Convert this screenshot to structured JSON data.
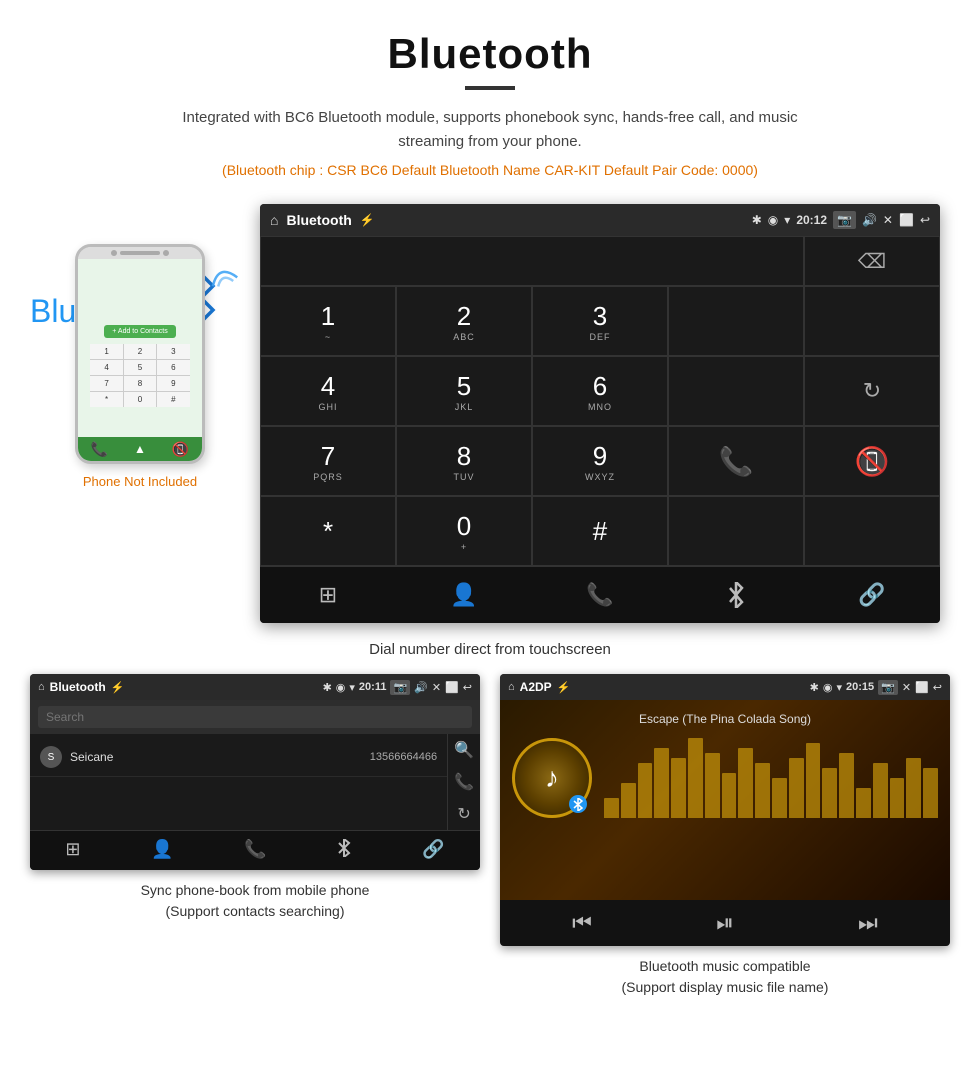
{
  "header": {
    "title": "Bluetooth",
    "subtitle": "Integrated with BC6 Bluetooth module, supports phonebook sync, hands-free call, and music streaming from your phone.",
    "specs": "(Bluetooth chip : CSR BC6    Default Bluetooth Name CAR-KIT    Default Pair Code: 0000)"
  },
  "phone": {
    "label": "Phone Not Included",
    "add_contacts": "+ Add to Contacts",
    "keys": [
      "1",
      "2",
      "3",
      "4",
      "5",
      "6",
      "7",
      "8",
      "9",
      "*",
      "0",
      "#"
    ]
  },
  "dial_screen": {
    "title": "Bluetooth",
    "time": "20:12",
    "keys": [
      {
        "num": "1",
        "sub": ""
      },
      {
        "num": "2",
        "sub": "ABC"
      },
      {
        "num": "3",
        "sub": "DEF"
      },
      {
        "num": "4",
        "sub": "GHI"
      },
      {
        "num": "5",
        "sub": "JKL"
      },
      {
        "num": "6",
        "sub": "MNO"
      },
      {
        "num": "7",
        "sub": "PQRS"
      },
      {
        "num": "8",
        "sub": "TUV"
      },
      {
        "num": "9",
        "sub": "WXYZ"
      },
      {
        "num": "*",
        "sub": ""
      },
      {
        "num": "0",
        "sub": "+"
      },
      {
        "num": "#",
        "sub": ""
      }
    ],
    "nav_icons": [
      "⊞",
      "👤",
      "📞",
      "✱",
      "⛓"
    ]
  },
  "main_caption": "Dial number direct from touchscreen",
  "phonebook_screen": {
    "title": "Bluetooth",
    "time": "20:11",
    "search_placeholder": "Search",
    "contact": {
      "initial": "S",
      "name": "Seicane",
      "number": "13566664466"
    }
  },
  "music_screen": {
    "title": "A2DP",
    "time": "20:15",
    "song": "Escape (The Pina Colada Song)",
    "eq_bars": [
      20,
      35,
      55,
      70,
      60,
      80,
      65,
      45,
      70,
      55,
      40,
      60,
      75,
      50,
      65,
      30,
      55,
      40,
      60,
      50
    ]
  },
  "captions": {
    "phonebook": "Sync phone-book from mobile phone\n(Support contacts searching)",
    "music": "Bluetooth music compatible\n(Support display music file name)"
  }
}
